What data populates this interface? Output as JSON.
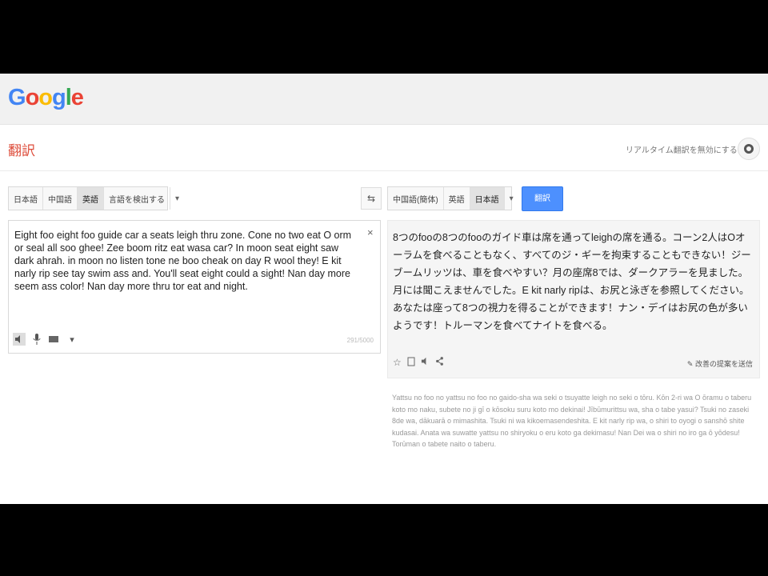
{
  "header": {
    "logo_letters": [
      {
        "ch": "G",
        "color": "#4285f4"
      },
      {
        "ch": "o",
        "color": "#ea4335"
      },
      {
        "ch": "o",
        "color": "#fbbc05"
      },
      {
        "ch": "g",
        "color": "#4285f4"
      },
      {
        "ch": "l",
        "color": "#34a853"
      },
      {
        "ch": "e",
        "color": "#ea4335"
      }
    ]
  },
  "subbar": {
    "title": "翻訳",
    "realtime_link": "リアルタイム翻訳を無効にする",
    "settings_icon": "gear-icon"
  },
  "source": {
    "languages": [
      "日本語",
      "中国語",
      "英語",
      "言語を検出する"
    ],
    "active_index": 2,
    "dropdown_icon": "▾",
    "text": "Eight foo eight foo guide car a seats leigh thru zone. Cone no two eat O orm or seal all soo ghee! Zee boom ritz eat wasa car? In moon seat eight saw dark ahrah. in moon no listen tone ne boo cheak on day R wool they! E kit narly rip see tay swim ass and. You'll seat eight could a sight! Nan day more seem ass color! Nan day more thru tor eat and night.",
    "clear_icon": "×",
    "char_count": "291/5000"
  },
  "swap": {
    "icon": "⇆"
  },
  "target": {
    "languages": [
      "中国語(簡体)",
      "英語",
      "日本語"
    ],
    "active_index": 2,
    "dropdown_icon": "▾",
    "translate_label": "翻訳",
    "text": "8つのfooの8つのfooのガイド車は席を通ってleighの席を通る。コーン2人はOオーラムを食べることもなく、すべてのジ・ギーを拘束することもできない！ジーブームリッツは、車を食べやすい？月の座席8では、ダークアラーを見ました。月には聞こえませんでした。E kit narly ripは、お尻と泳ぎを参照してください。あなたは座って8つの視力を得ることができます！ナン・デイはお尻の色が多いようです！トルーマンを食べてナイトを食べる。",
    "suggest_edit": "改善の提案を送信",
    "romaji": "Yattsu no foo no yattsu no foo no gaido-sha wa seki o tsuyatte leigh no seki o tōru. Kōn 2-ri wa O ōramu o taberu koto mo naku, subete no ji gī o kōsoku suru koto mo dekinai! Jībūmurittsu wa, sha o tabe yasui? Tsuki no zaseki 8de wa, dākuarā o mimashita. Tsuki ni wa kikoemasendeshita. E kit narly rip wa, o shiri to oyogi o sanshō shite kudasai. Anata wa suwatte yattsu no shiryoku o eru koto ga dekimasu! Nan Dei wa o shiri no iro ga ō yōdesu! Torūman o tabete naito o taberu."
  }
}
